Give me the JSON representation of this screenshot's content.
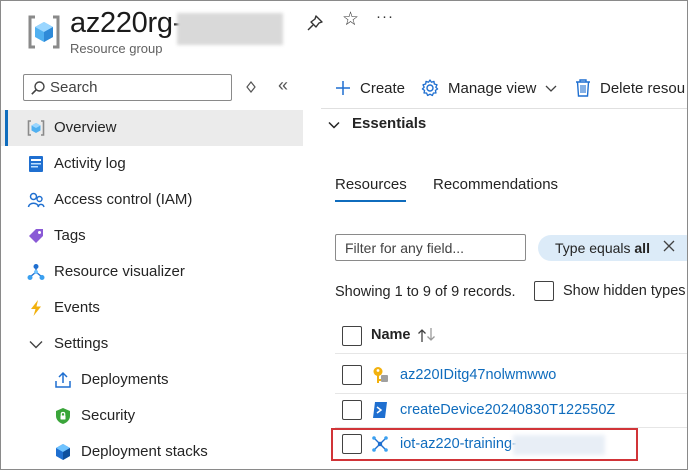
{
  "header": {
    "title": "az220rg-",
    "subtitle": "Resource group",
    "pin_icon": "pin-icon",
    "star_icon": "star-icon",
    "more_label": "···"
  },
  "sidebar": {
    "search_placeholder": "Search",
    "items": [
      {
        "label": "Overview",
        "icon": "resource-group-icon",
        "active": true
      },
      {
        "label": "Activity log",
        "icon": "activity-log-icon"
      },
      {
        "label": "Access control (IAM)",
        "icon": "people-icon"
      },
      {
        "label": "Tags",
        "icon": "tag-icon"
      },
      {
        "label": "Resource visualizer",
        "icon": "visualizer-icon"
      },
      {
        "label": "Events",
        "icon": "lightning-icon"
      },
      {
        "label": "Settings",
        "icon": "chevron-down-icon",
        "expanded": true
      },
      {
        "label": "Deployments",
        "icon": "upload-icon"
      },
      {
        "label": "Security",
        "icon": "shield-icon"
      },
      {
        "label": "Deployment stacks",
        "icon": "stack-icon"
      }
    ]
  },
  "toolbar": {
    "create_label": "Create",
    "manage_view_label": "Manage view",
    "delete_label": "Delete resou"
  },
  "essentials": {
    "label": "Essentials"
  },
  "tabs": [
    {
      "label": "Resources",
      "selected": true
    },
    {
      "label": "Recommendations",
      "selected": false
    }
  ],
  "filter": {
    "placeholder": "Filter for any field...",
    "pill_prefix": "Type equals ",
    "pill_value": "all"
  },
  "records_text": "Showing 1 to 9 of 9 records.",
  "show_hidden_label": "Show hidden types",
  "table": {
    "column_name": "Name",
    "sort_icon": "sort-arrows-icon",
    "rows": [
      {
        "name": "az220IDitg47nolwmwwo",
        "icon": "key-icon"
      },
      {
        "name": "createDevice20240830T122550Z",
        "icon": "script-icon"
      },
      {
        "name": "iot-az220-training-",
        "icon": "iot-hub-icon",
        "highlighted": true
      }
    ]
  },
  "colors": {
    "accent": "#0f6cbd",
    "highlight_border": "#d13438",
    "active_nav_bg": "#ebebeb",
    "pill_bg": "#dcebf8"
  }
}
